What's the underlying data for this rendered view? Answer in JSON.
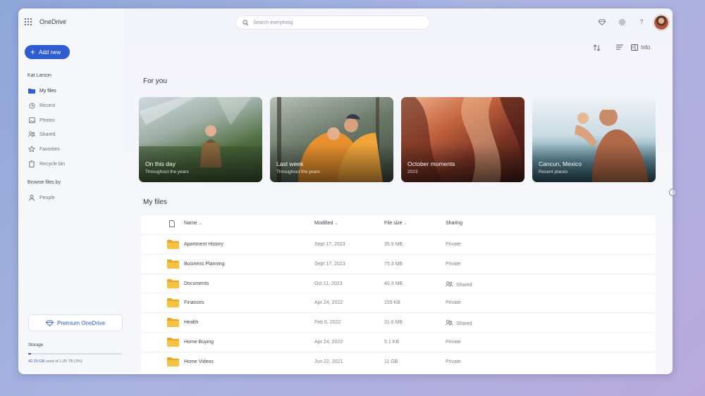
{
  "app": {
    "title": "OneDrive"
  },
  "search": {
    "placeholder": "Search everything"
  },
  "topbar": {
    "icons": [
      "diamond-icon",
      "gear-icon",
      "help-icon",
      "avatar"
    ],
    "help_label": "?"
  },
  "sidebar": {
    "add_new": "Add new",
    "user": "Kat Larson",
    "items": [
      {
        "label": "My files",
        "icon": "folder-icon",
        "active": true
      },
      {
        "label": "Recent",
        "icon": "clock-icon"
      },
      {
        "label": "Photos",
        "icon": "image-icon"
      },
      {
        "label": "Shared",
        "icon": "people-icon"
      },
      {
        "label": "Favorites",
        "icon": "star-icon"
      },
      {
        "label": "Recycle bin",
        "icon": "trash-icon"
      }
    ],
    "browse_title": "Browse files by",
    "browse_items": [
      {
        "label": "People",
        "icon": "person-icon"
      }
    ],
    "premium": "Premium OneDrive",
    "storage": {
      "label": "Storage",
      "used_text": "42.29 GB",
      "of_text": " used of 1.05 TB (3%)",
      "fraction": 0.03
    }
  },
  "toolbar": {
    "info": "Info",
    "icons": [
      "sort-icon",
      "view-icon",
      "info-icon"
    ]
  },
  "for_you": {
    "title": "For you",
    "cards": [
      {
        "title": "On this day",
        "subtitle": "Throughout the years"
      },
      {
        "title": "Last week",
        "subtitle": "Throughout the years"
      },
      {
        "title": "October moments",
        "subtitle": "2023"
      },
      {
        "title": "Cancun, Mexico",
        "subtitle": "Recent places"
      }
    ]
  },
  "my_files": {
    "title": "My files",
    "columns": {
      "name": "Name",
      "modified": "Modified",
      "size": "File size",
      "sharing": "Sharing"
    },
    "rows": [
      {
        "name": "Apartment History",
        "modified": "Sept 17, 2023",
        "size": "35.9 MB",
        "sharing": "Private",
        "shared": false
      },
      {
        "name": "Business Planning",
        "modified": "Sept 17, 2023",
        "size": "75.3 MB",
        "sharing": "Private",
        "shared": false
      },
      {
        "name": "Documents",
        "modified": "Oct 11, 2023",
        "size": "40.3 MB",
        "sharing": "Shared",
        "shared": true
      },
      {
        "name": "Finances",
        "modified": "Apr 24, 2022",
        "size": "159 KB",
        "sharing": "Private",
        "shared": false
      },
      {
        "name": "Health",
        "modified": "Feb 6, 2022",
        "size": "31.6 MB",
        "sharing": "Shared",
        "shared": true
      },
      {
        "name": "Home Buying",
        "modified": "Apr 24, 2022",
        "size": "5.1 KB",
        "sharing": "Private",
        "shared": false
      },
      {
        "name": "Home Videos",
        "modified": "Jun 22, 2021",
        "size": "11 GB",
        "sharing": "Private",
        "shared": false
      }
    ]
  },
  "colors": {
    "accent": "#2f5cd1",
    "folder": "#f5c242"
  }
}
